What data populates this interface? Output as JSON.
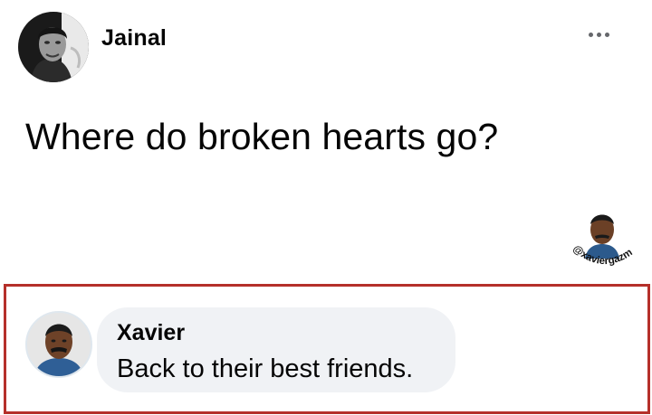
{
  "post": {
    "author_name": "Jainal",
    "text": "Where do broken hearts go?",
    "more_icon": "more-horizontal-icon"
  },
  "watermark": {
    "handle": "@xaviergazm"
  },
  "comment": {
    "author_name": "Xavier",
    "text": "Back to their best friends.",
    "highlight_color": "#b5302a"
  },
  "colors": {
    "bubble": "#f0f2f5",
    "text": "#050505",
    "icon_gray": "#65676b"
  }
}
